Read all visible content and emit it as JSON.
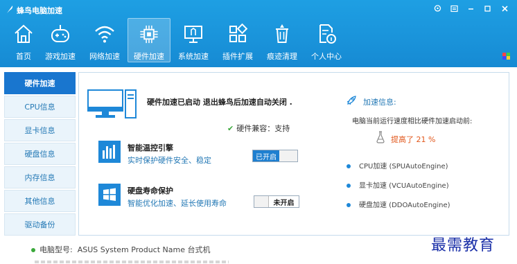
{
  "window": {
    "title": "蜂鸟电脑加速",
    "controls": [
      "skin-icon",
      "menu-icon",
      "minimize-icon",
      "maximize-icon",
      "close-icon"
    ]
  },
  "nav": {
    "items": [
      {
        "label": "首页",
        "icon": "home-icon"
      },
      {
        "label": "游戏加速",
        "icon": "gamepad-icon"
      },
      {
        "label": "网络加速",
        "icon": "wifi-icon"
      },
      {
        "label": "硬件加速",
        "icon": "chip-icon",
        "active": true
      },
      {
        "label": "系统加速",
        "icon": "monitor-icon"
      },
      {
        "label": "插件扩展",
        "icon": "plugin-icon"
      },
      {
        "label": "痕迹清理",
        "icon": "trash-icon"
      },
      {
        "label": "个人中心",
        "icon": "user-doc-icon"
      }
    ]
  },
  "sidebar": {
    "items": [
      {
        "label": "硬件加速",
        "active": true
      },
      {
        "label": "CPU信息"
      },
      {
        "label": "显卡信息"
      },
      {
        "label": "硬盘信息"
      },
      {
        "label": "内存信息"
      },
      {
        "label": "其他信息"
      },
      {
        "label": "驱动备份"
      }
    ]
  },
  "main": {
    "status": "硬件加速已启动  退出蜂鸟后加速自动关闭 .",
    "compat": "硬件兼容：支持",
    "features": [
      {
        "title": "智能温控引擎",
        "desc": "实时保护硬件安全、稳定",
        "toggle": "已开启",
        "enabled": true
      },
      {
        "title": "硬盘寿命保护",
        "desc": "智能优化加速、延长使用寿命",
        "toggle": "未开启",
        "enabled": false
      }
    ],
    "accel": {
      "heading": "加速信息:",
      "desc": "电脑当前运行速度相比硬件加速启动前:",
      "result": "提高了 21 %",
      "engines": [
        "CPU加速 (SPUAutoEngine)",
        "显卡加速 (VCUAutoEngine)",
        "硬盘加速 (DDOAutoEngine)"
      ]
    }
  },
  "footer": {
    "model_label": "电脑型号:",
    "model_value": "ASUS System Product Name 台式机"
  },
  "watermark": "最需教育",
  "colors": {
    "accent": "#1a93da",
    "active": "#1976cf",
    "link": "#2378b5",
    "highlight": "#e2571b"
  }
}
